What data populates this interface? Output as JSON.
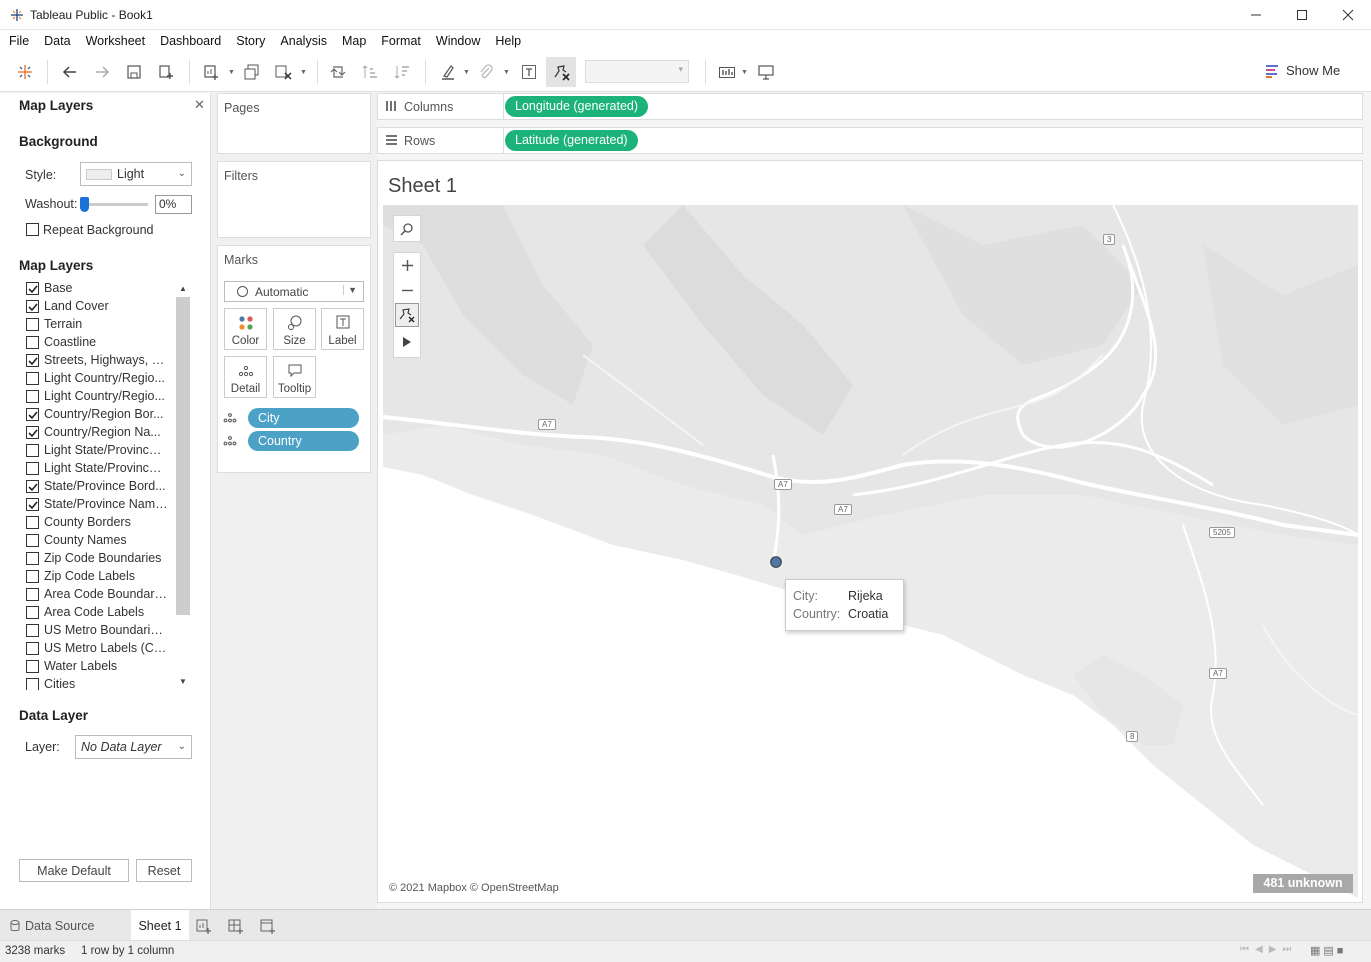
{
  "window": {
    "title": "Tableau Public - Book1"
  },
  "menu": [
    "File",
    "Data",
    "Worksheet",
    "Dashboard",
    "Story",
    "Analysis",
    "Map",
    "Format",
    "Window",
    "Help"
  ],
  "toolbar": {
    "show_me": "Show Me"
  },
  "map_layers_panel": {
    "title": "Map Layers",
    "background_heading": "Background",
    "style_label": "Style:",
    "style_value": "Light",
    "washout_label": "Washout:",
    "washout_value": "0%",
    "washout_fraction": 0,
    "repeat_background": "Repeat Background",
    "repeat_background_checked": false,
    "layers_heading": "Map Layers",
    "layers": [
      {
        "name": "Base",
        "checked": true
      },
      {
        "name": "Land Cover",
        "checked": true
      },
      {
        "name": "Terrain",
        "checked": false
      },
      {
        "name": "Coastline",
        "checked": false
      },
      {
        "name": "Streets, Highways, R...",
        "checked": true
      },
      {
        "name": "Light Country/Regio...",
        "checked": false
      },
      {
        "name": "Light Country/Regio...",
        "checked": false
      },
      {
        "name": "Country/Region Bor...",
        "checked": true
      },
      {
        "name": "Country/Region Na...",
        "checked": true
      },
      {
        "name": "Light State/Province ...",
        "checked": false
      },
      {
        "name": "Light State/Province ...",
        "checked": false
      },
      {
        "name": "State/Province Bord...",
        "checked": true
      },
      {
        "name": "State/Province Names",
        "checked": true
      },
      {
        "name": "County Borders",
        "checked": false
      },
      {
        "name": "County Names",
        "checked": false
      },
      {
        "name": "Zip Code Boundaries",
        "checked": false
      },
      {
        "name": "Zip Code Labels",
        "checked": false
      },
      {
        "name": "Area Code Boundaries",
        "checked": false
      },
      {
        "name": "Area Code Labels",
        "checked": false
      },
      {
        "name": "US Metro Boundaries...",
        "checked": false
      },
      {
        "name": "US Metro Labels (CB...",
        "checked": false
      },
      {
        "name": "Water Labels",
        "checked": false
      },
      {
        "name": "Cities",
        "checked": false
      }
    ],
    "data_layer_heading": "Data Layer",
    "layer_label": "Layer:",
    "layer_value": "No Data Layer",
    "make_default": "Make Default",
    "reset": "Reset"
  },
  "cards": {
    "pages": "Pages",
    "filters": "Filters",
    "marks": "Marks",
    "mark_type": "Automatic",
    "mark_buttons": [
      "Color",
      "Size",
      "Label",
      "Detail",
      "Tooltip"
    ],
    "mark_pills": [
      "City",
      "Country"
    ]
  },
  "shelves": {
    "columns_label": "Columns",
    "columns_pill": "Longitude (generated)",
    "rows_label": "Rows",
    "rows_pill": "Latitude (generated)"
  },
  "sheet": {
    "title": "Sheet 1",
    "road_labels": [
      "3",
      "A7",
      "A7",
      "A7",
      "5205",
      "A7",
      "8"
    ],
    "tooltip": {
      "city_key": "City:",
      "city_value": "Rijeka",
      "country_key": "Country:",
      "country_value": "Croatia"
    },
    "attribution": "© 2021 Mapbox © OpenStreetMap",
    "unknown": "481 unknown"
  },
  "tabs": {
    "data_source": "Data Source",
    "sheet": "Sheet 1"
  },
  "status": {
    "marks": "3238 marks",
    "dims": "1 row by 1 column"
  },
  "colors": {
    "green_pill": "#1cb37b",
    "blue_pill": "#4ca1c6",
    "mark": "#4e79a7"
  }
}
